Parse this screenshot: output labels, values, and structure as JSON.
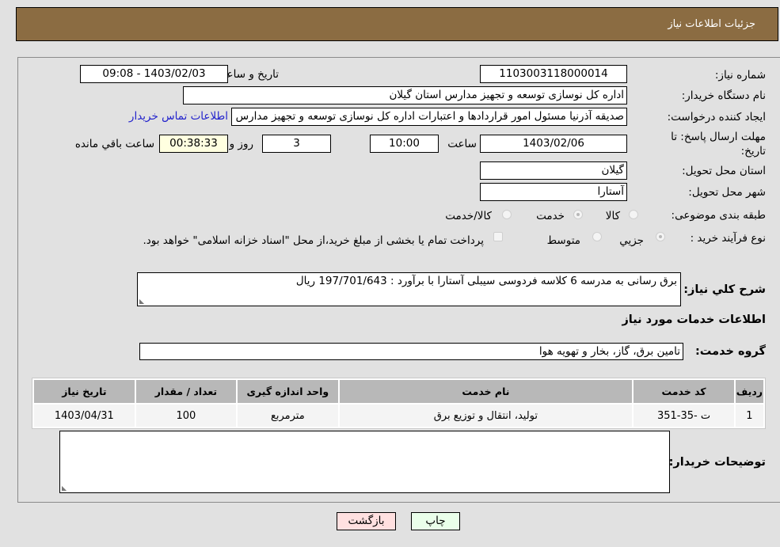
{
  "header": {
    "title": "جزئیات اطلاعات نیاز"
  },
  "fields": {
    "need_number": {
      "label": "شماره نیاز:",
      "value": "1103003118000014"
    },
    "announce_datetime": {
      "label": "تاریخ و ساعت اعلان عمومی:",
      "value": "1403/02/03 - 09:08"
    },
    "buyer_org": {
      "label": "نام دستگاه خریدار:",
      "value": "اداره کل نوسازی  توسعه و تجهیز مدارس استان گیلان"
    },
    "requester": {
      "label": "ایجاد کننده درخواست:",
      "value": "صدیقه آذرنیا مسئول امور قراردادها و اعتبارات اداره کل نوسازی  توسعه و تجهیز مدارس استان گیلان",
      "contact_link": "اطلاعات تماس خریدار"
    },
    "deadline": {
      "label": "مهلت ارسال پاسخ: تا تاریخ:",
      "date": "1403/02/06",
      "time_label": "ساعت",
      "time": "10:00",
      "days": "3",
      "days_label": "روز و",
      "remaining": "00:38:33",
      "remaining_label": "ساعت باقي مانده"
    },
    "province": {
      "label": "استان محل تحویل:",
      "value": "گیلان"
    },
    "city": {
      "label": "شهر محل تحویل:",
      "value": "آستارا"
    },
    "category": {
      "label": "طبقه بندی موضوعی:",
      "options": [
        "کالا",
        "خدمت",
        "کالا/خدمت"
      ],
      "selected": "خدمت"
    },
    "process": {
      "label": "نوع فرآیند خرید :",
      "options": [
        "جزیي",
        "متوسط"
      ],
      "selected": "جزیي",
      "note": "پرداخت تمام یا بخشی از مبلغ خرید،از محل \"اسناد خزانه اسلامی\" خواهد بود."
    }
  },
  "description": {
    "label": "شرح کلي نیاز:",
    "value": "برق رسانی به مدرسه 6 کلاسه فردوسی سیبلی آستارا با برآورد : 197/701/643 ریال"
  },
  "services_section": {
    "title": "اطلاعات خدمات مورد نیاز"
  },
  "service_group": {
    "label": "گروه خدمت:",
    "value": "تامین برق، گاز، بخار و تهویه هوا"
  },
  "table": {
    "headers": [
      "ردیف",
      "کد خدمت",
      "نام خدمت",
      "واحد اندازه گیری",
      "تعداد / مقدار",
      "تاریخ نیاز"
    ],
    "rows": [
      [
        "1",
        "ت -35-351",
        "تولید، انتقال و توزیع برق",
        "مترمربع",
        "100",
        "1403/04/31"
      ]
    ]
  },
  "buyer_notes": {
    "label": "توضیحات خریدار:",
    "value": ""
  },
  "buttons": {
    "print": "چاپ",
    "back": "بازگشت"
  },
  "colors": {
    "header_bg": "#8b6c42",
    "print_bg": "#eaffea",
    "back_bg": "#ffe0e0",
    "link": "#2222cc"
  }
}
